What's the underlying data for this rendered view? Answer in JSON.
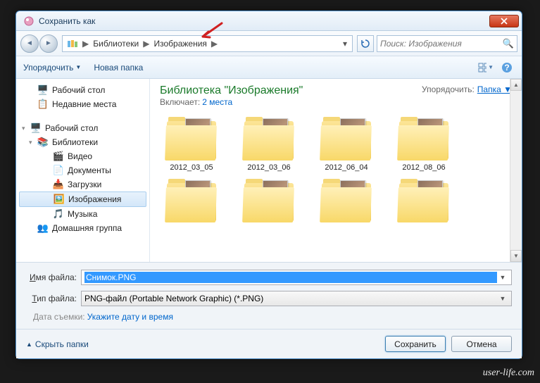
{
  "window": {
    "title": "Сохранить как"
  },
  "nav": {
    "back_glyph": "◄",
    "fwd_glyph": "►"
  },
  "breadcrumb": {
    "seg1": "Библиотеки",
    "seg2": "Изображения"
  },
  "search": {
    "placeholder": "Поиск: Изображения"
  },
  "toolbar": {
    "organize": "Упорядочить",
    "new_folder": "Новая папка"
  },
  "sidebar": {
    "desktop": "Рабочий стол",
    "recent": "Недавние места",
    "desktop2": "Рабочий стол",
    "libraries": "Библиотеки",
    "video": "Видео",
    "documents": "Документы",
    "downloads": "Загрузки",
    "images": "Изображения",
    "music": "Музыка",
    "homegroup": "Домашняя группа"
  },
  "library": {
    "title": "Библиотека \"Изображения\"",
    "includes_label": "Включает:",
    "includes_link": "2 места",
    "arrange_label": "Упорядочить:",
    "arrange_value": "Папка"
  },
  "folders": [
    {
      "name": "2012_03_05"
    },
    {
      "name": "2012_03_06"
    },
    {
      "name": "2012_06_04"
    },
    {
      "name": "2012_08_06"
    }
  ],
  "fields": {
    "filename_label": "Имя файла:",
    "filename_value": "Снимок.PNG",
    "filetype_label": "Тип файла:",
    "filetype_value": "PNG-файл (Portable Network Graphic) (*.PNG)",
    "date_label": "Дата съемки:",
    "date_link": "Укажите дату и время"
  },
  "footer": {
    "hide_folders": "Скрыть папки",
    "save": "Сохранить",
    "cancel": "Отмена"
  },
  "watermark": "user-life.com"
}
